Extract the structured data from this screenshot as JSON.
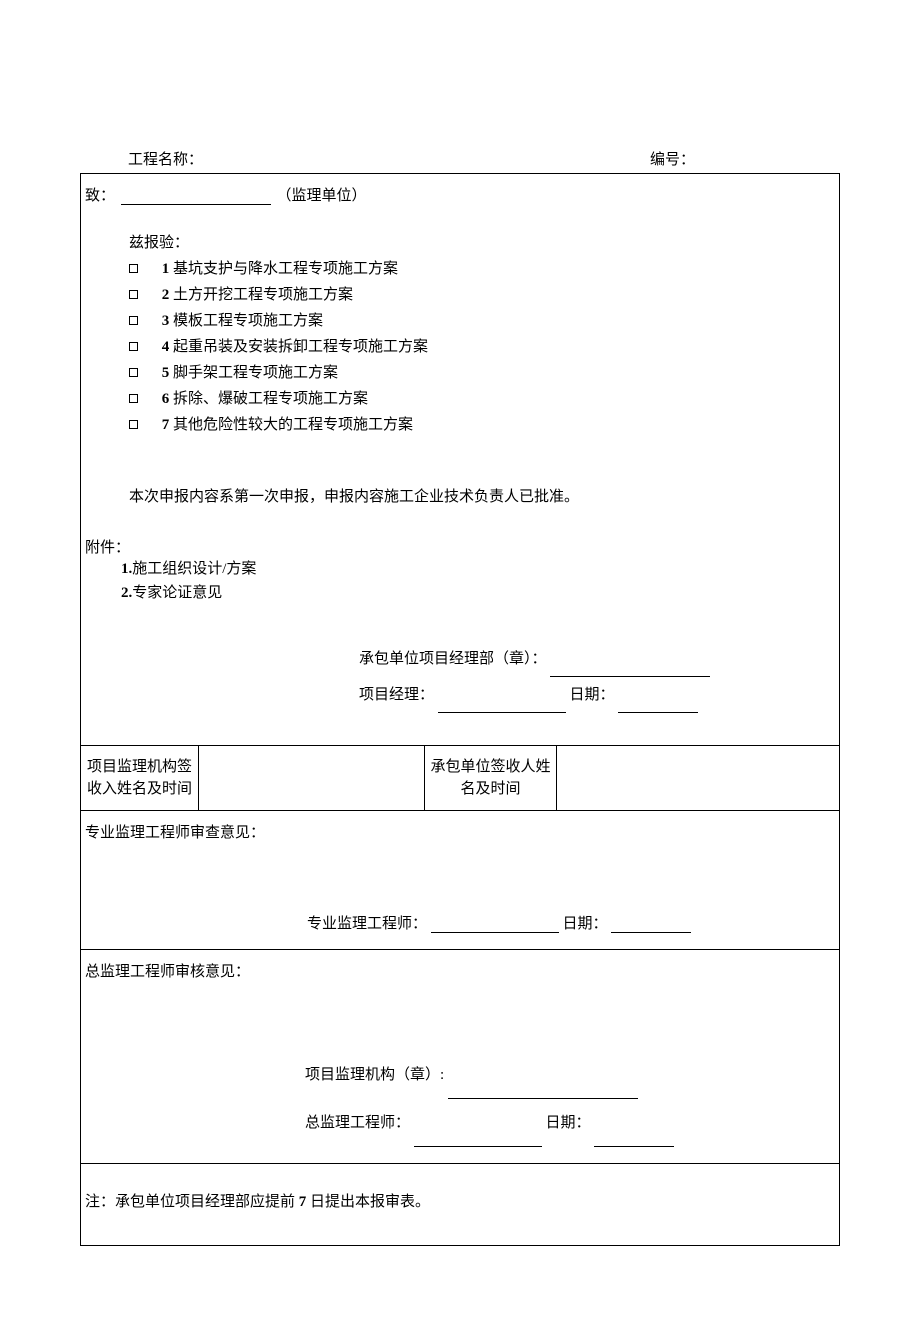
{
  "header": {
    "project_name_label": "工程名称：",
    "serial_label": "编号："
  },
  "to": {
    "prefix": "致：",
    "suffix": "（监理单位）"
  },
  "intro": "兹报验：",
  "items": [
    {
      "num": "1",
      "text": " 基坑支护与降水工程专项施工方案"
    },
    {
      "num": "2",
      "text": " 土方开挖工程专项施工方案"
    },
    {
      "num": "3",
      "text": " 模板工程专项施工方案"
    },
    {
      "num": "4",
      "text": " 起重吊装及安装拆卸工程专项施工方案"
    },
    {
      "num": "5",
      "text": " 脚手架工程专项施工方案"
    },
    {
      "num": "6",
      "text": " 拆除、爆破工程专项施工方案"
    },
    {
      "num": "7",
      "text": " 其他危险性较大的工程专项施工方案"
    }
  ],
  "declare_note": "本次申报内容系第一次申报，申报内容施工企业技术负责人已批准。",
  "attach": {
    "label": "附件：",
    "a1_num": "1.",
    "a1_text": "施工组织设计/方案",
    "a2_num": "2.",
    "a2_text": "专家论证意见"
  },
  "sign1": {
    "dept": "承包单位项目经理部（章）：",
    "pm_label": "项目经理：",
    "date_label": "日期："
  },
  "receipt": {
    "col1": "项目监理机构签收入姓名及时间",
    "col3": "承包单位签收人姓名及时间"
  },
  "review1": {
    "title": "专业监理工程师审查意见：",
    "signer": "专业监理工程师：",
    "date": "日期："
  },
  "review2": {
    "title": "总监理工程师审核意见：",
    "org": "项目监理机构（章）:",
    "signer": "总监理工程师：",
    "date": "日期："
  },
  "note": {
    "prefix": "注：承包单位项目经理部应提前 ",
    "days": "7",
    "suffix": " 日提出本报审表。"
  }
}
